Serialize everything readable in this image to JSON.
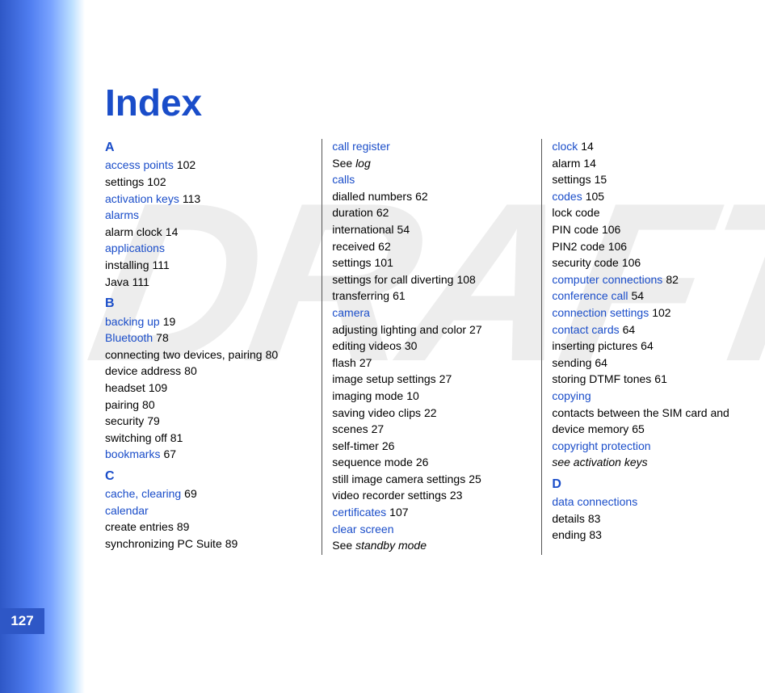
{
  "page_number": "127",
  "title": "Index",
  "watermark": "DRAFT",
  "col1": {
    "letterA": "A",
    "access_points": "access points",
    "access_points_p": "102",
    "ap_settings": "settings",
    "ap_settings_p": "102",
    "activation_keys": "activation keys",
    "activation_keys_p": "113",
    "alarms": "alarms",
    "alarm_clock": "alarm clock",
    "alarm_clock_p": "14",
    "applications": "applications",
    "app_install": "installing",
    "app_install_p": "111",
    "app_java": "Java",
    "app_java_p": "111",
    "letterB": "B",
    "backing_up": "backing up",
    "backing_up_p": "19",
    "bluetooth": "Bluetooth",
    "bluetooth_p": "78",
    "bt_pairing2": "connecting two devices, pairing",
    "bt_pairing2_p": "80",
    "bt_addr": "device address",
    "bt_addr_p": "80",
    "bt_headset": "headset",
    "bt_headset_p": "109",
    "bt_pairing": "pairing",
    "bt_pairing_p": "80",
    "bt_sec": "security",
    "bt_sec_p": "79",
    "bt_off": "switching off",
    "bt_off_p": "81",
    "bookmarks": "bookmarks",
    "bookmarks_p": "67",
    "letterC": "C",
    "cache": "cache, clearing",
    "cache_p": "69",
    "calendar": "calendar",
    "cal_create": "create entries",
    "cal_create_p": "89",
    "cal_sync": "synchronizing PC Suite",
    "cal_sync_p": "89"
  },
  "col2": {
    "call_register": "call register",
    "see_log_pre": "See ",
    "see_log": "log",
    "calls": "calls",
    "c_dialled": "dialled numbers",
    "c_dialled_p": "62",
    "c_duration": "duration",
    "c_duration_p": "62",
    "c_intl": "international",
    "c_intl_p": "54",
    "c_recv": "received",
    "c_recv_p": "62",
    "c_set": "settings",
    "c_set_p": "101",
    "c_divert": "settings for call diverting",
    "c_divert_p": "108",
    "c_xfer": "transferring",
    "c_xfer_p": "61",
    "camera": "camera",
    "cam_light": "adjusting lighting and color",
    "cam_light_p": "27",
    "cam_vid": "editing videos",
    "cam_vid_p": "30",
    "cam_flash": "flash",
    "cam_flash_p": "27",
    "cam_img_set": "image setup settings",
    "cam_img_set_p": "27",
    "cam_mode": "imaging mode",
    "cam_mode_p": "10",
    "cam_save": "saving video clips",
    "cam_save_p": "22",
    "cam_scenes": "scenes",
    "cam_scenes_p": "27",
    "cam_timer": "self-timer",
    "cam_timer_p": "26",
    "cam_seq": "sequence mode",
    "cam_seq_p": "26",
    "cam_still": "still image camera settings",
    "cam_still_p": "25",
    "cam_vrec": "video recorder settings",
    "cam_vrec_p": "23",
    "certs": "certificates",
    "certs_p": "107",
    "clear_screen": "clear screen",
    "cs_see_pre": "See ",
    "cs_see": "standby mode"
  },
  "col3": {
    "clock": "clock",
    "clock_p": "14",
    "clk_alarm": "alarm",
    "clk_alarm_p": "14",
    "clk_set": "settings",
    "clk_set_p": "15",
    "codes": "codes",
    "codes_p": "105",
    "cd_lock": "lock code",
    "cd_pin": "PIN code",
    "cd_pin_p": "106",
    "cd_pin2": "PIN2 code",
    "cd_pin2_p": "106",
    "cd_sec": "security code",
    "cd_sec_p": "106",
    "comp_conn": "computer connections",
    "comp_conn_p": "82",
    "conf_call": "conference call",
    "conf_call_p": "54",
    "conn_set": "connection settings",
    "conn_set_p": "102",
    "contact_cards": "contact cards",
    "contact_cards_p": "64",
    "cc_pics": "inserting pictures",
    "cc_pics_p": "64",
    "cc_send": "sending",
    "cc_send_p": "64",
    "cc_dtmf": "storing DTMF tones",
    "cc_dtmf_p": "61",
    "copying": "copying",
    "copy_line1": "contacts between the SIM card and",
    "copy_line2": "device memory",
    "copy_line2_p": "65",
    "copyright": "copyright protection",
    "cp_see": "see activation keys",
    "letterD": "D",
    "data_conn": "data connections",
    "dc_details": "details",
    "dc_details_p": "83",
    "dc_ending": "ending",
    "dc_ending_p": "83"
  }
}
